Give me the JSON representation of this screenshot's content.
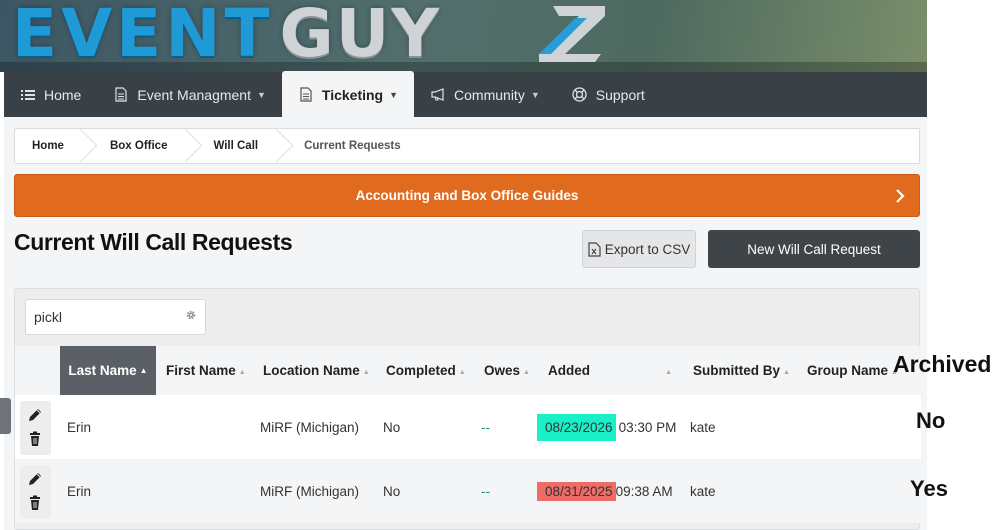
{
  "brand": {
    "logo_event": "EVENT",
    "logo_guy": "GUY",
    "logo_letter": "Z",
    "event_color": "#1f9ad6",
    "guy_color": "#cfd3d6"
  },
  "nav": {
    "items": [
      {
        "label": "Home",
        "icon": "list-icon",
        "caret": false,
        "active": false
      },
      {
        "label": "Event Managment",
        "icon": "document-icon",
        "caret": true,
        "active": false
      },
      {
        "label": "Ticketing",
        "icon": "document-icon",
        "caret": true,
        "active": true
      },
      {
        "label": "Community",
        "icon": "megaphone-icon",
        "caret": true,
        "active": false
      },
      {
        "label": "Support",
        "icon": "lifebuoy-icon",
        "caret": false,
        "active": false
      }
    ]
  },
  "breadcrumb": [
    "Home",
    "Box Office",
    "Will Call",
    "Current Requests"
  ],
  "guide_bar": {
    "label": "Accounting and Box Office Guides",
    "color": "#e06a1e"
  },
  "page": {
    "title": "Current Will Call Requests",
    "export_label": "Export to CSV",
    "new_label": "New Will Call Request"
  },
  "search": {
    "value": "pickl"
  },
  "table": {
    "columns": [
      "Last Name",
      "First Name",
      "Location Name",
      "Completed",
      "Owes",
      "Added",
      "Submitted By",
      "Group Name"
    ],
    "sorted_column": "Last Name",
    "archived_header": "Archived",
    "rows": [
      {
        "last_name": "Erin",
        "first_name": "",
        "location": "MiRF (Michigan)",
        "completed": "No",
        "owes": "--",
        "added_date": "08/23/2026",
        "added_time": "03:30 PM",
        "date_color": "#19f0c8",
        "submitted_by": "kate",
        "group_name": "",
        "archived": "No"
      },
      {
        "last_name": "Erin",
        "first_name": "",
        "location": "MiRF (Michigan)",
        "completed": "No",
        "owes": "--",
        "added_date": "08/31/2025",
        "added_time": "09:38 AM",
        "date_color": "#ef6b66",
        "submitted_by": "kate",
        "group_name": "",
        "archived": "Yes"
      }
    ]
  }
}
